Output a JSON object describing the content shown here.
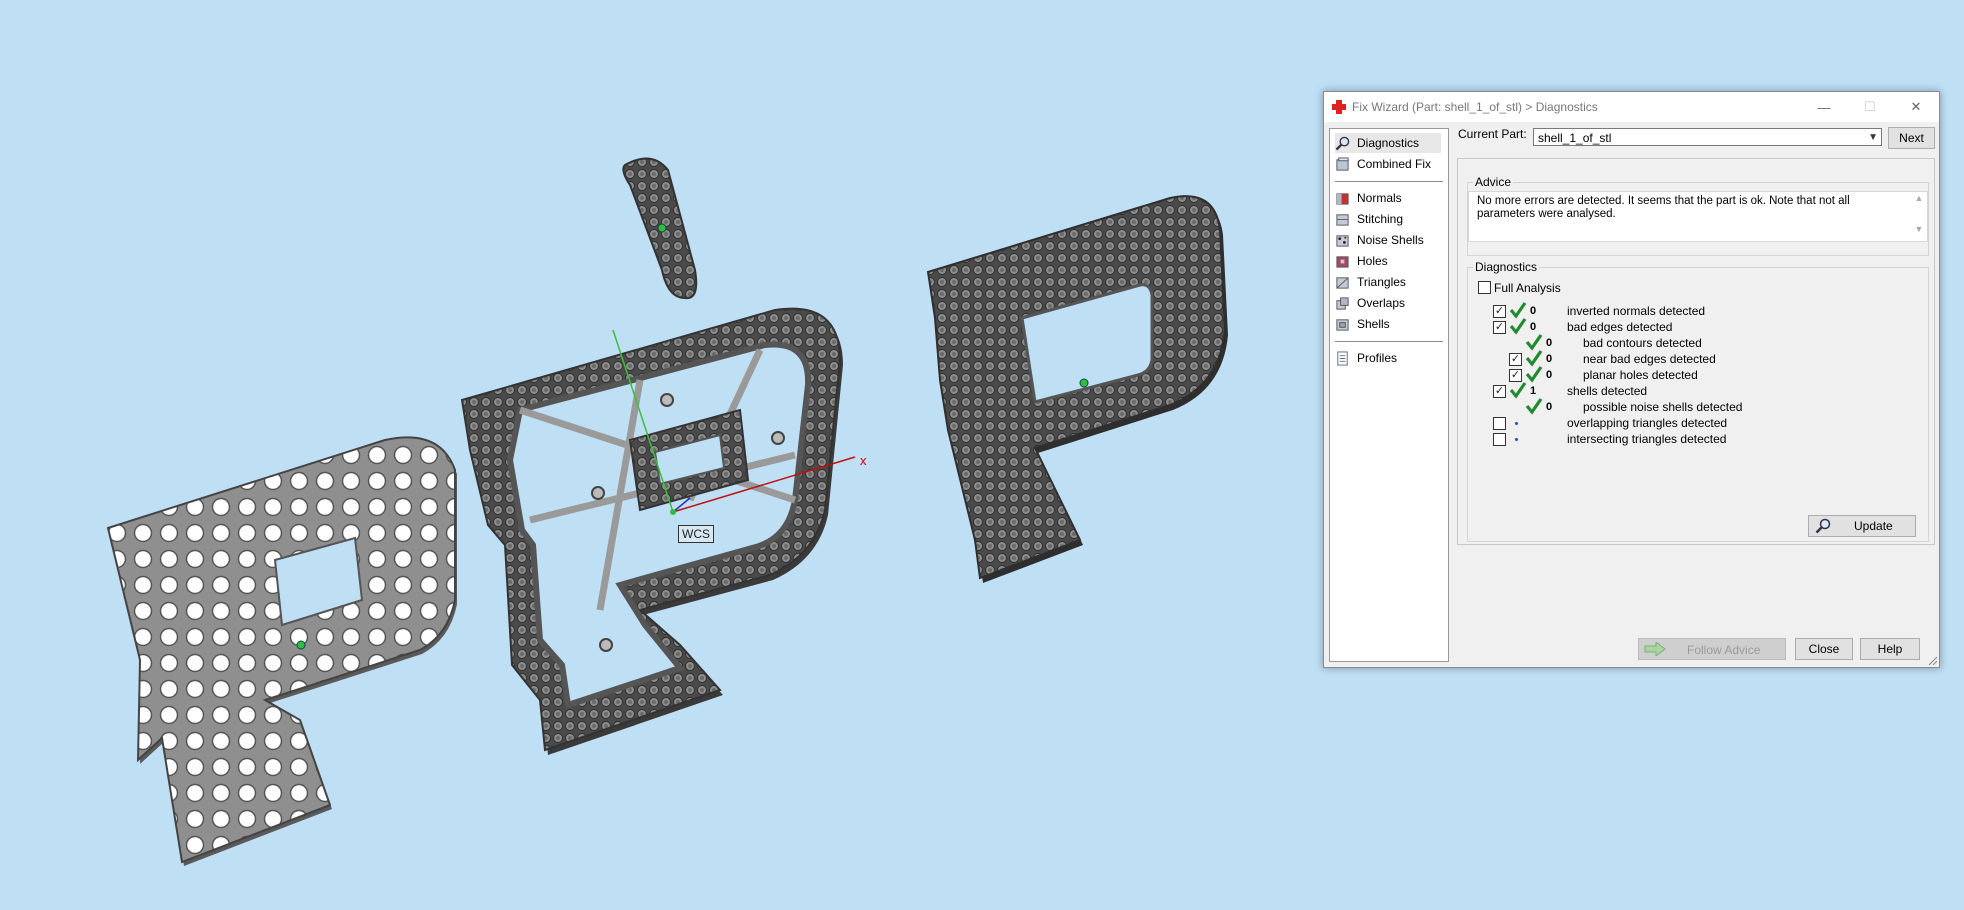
{
  "viewport": {
    "wcs_label": "WCS",
    "axis_x_label": "x",
    "background": "#bfdff5"
  },
  "dialog": {
    "title": "Fix Wizard (Part: shell_1_of_stl) > Diagnostics",
    "window_controls": {
      "minimize": "—",
      "maximize": "☐",
      "close": "✕"
    },
    "sidebar": {
      "top_items": [
        {
          "label": "Diagnostics",
          "icon": "magnifier-icon"
        },
        {
          "label": "Combined Fix",
          "icon": "cube-icon"
        }
      ],
      "tool_items": [
        {
          "label": "Normals",
          "icon": "normals-icon"
        },
        {
          "label": "Stitching",
          "icon": "stitching-icon"
        },
        {
          "label": "Noise Shells",
          "icon": "noise-shells-icon"
        },
        {
          "label": "Holes",
          "icon": "holes-icon"
        },
        {
          "label": "Triangles",
          "icon": "triangles-icon"
        },
        {
          "label": "Overlaps",
          "icon": "overlaps-icon"
        },
        {
          "label": "Shells",
          "icon": "shells-icon"
        }
      ],
      "profiles": {
        "label": "Profiles",
        "icon": "document-icon"
      }
    },
    "current_part": {
      "label": "Current Part:",
      "value": "shell_1_of_stl",
      "next_label": "Next"
    },
    "advice": {
      "title": "Advice",
      "text_line1": "No more errors are detected. It seems that the part is ok. Note that not all",
      "text_line2": "parameters were analysed."
    },
    "diagnostics": {
      "title": "Diagnostics",
      "full_analysis_label": "Full Analysis",
      "rows": [
        {
          "checked": true,
          "status": "ok",
          "count": "0",
          "label": "inverted normals detected"
        },
        {
          "checked": true,
          "status": "ok",
          "count": "0",
          "label": "bad edges detected"
        },
        {
          "checked": null,
          "status": "ok",
          "count": "0",
          "label": "bad contours detected"
        },
        {
          "checked": true,
          "status": "ok",
          "count": "0",
          "label": "near bad edges detected"
        },
        {
          "checked": true,
          "status": "ok",
          "count": "0",
          "label": "planar holes detected"
        },
        {
          "checked": true,
          "status": "ok",
          "count": "1",
          "label": "shells detected"
        },
        {
          "checked": null,
          "status": "ok",
          "count": "0",
          "label": "possible noise shells detected"
        },
        {
          "checked": false,
          "status": "none",
          "count": "",
          "label": "overlapping triangles detected"
        },
        {
          "checked": false,
          "status": "none",
          "count": "",
          "label": "intersecting triangles detected"
        }
      ],
      "update_label": "Update"
    },
    "footer": {
      "follow_advice_label": "Follow Advice",
      "close_label": "Close",
      "help_label": "Help"
    }
  }
}
